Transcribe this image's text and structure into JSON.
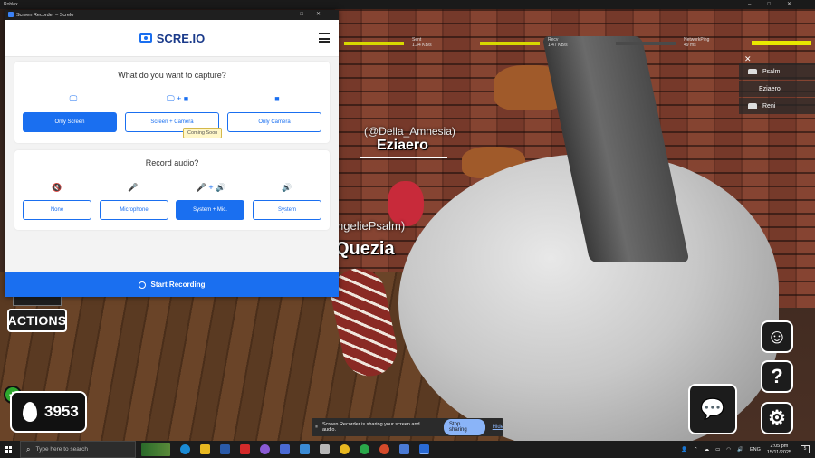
{
  "roblox": {
    "title": "Roblox"
  },
  "recorder": {
    "window_title": "Screen Recorder – Screlo",
    "logo_text": "SCRE.IO",
    "capture": {
      "title": "What do you want to capture?",
      "options": [
        "Only Screen",
        "Screen + Camera",
        "Only Camera"
      ],
      "selected": "Only Screen",
      "tooltip": "Coming Soon"
    },
    "audio": {
      "title": "Record audio?",
      "options": [
        "None",
        "Microphone",
        "System + Mic.",
        "System"
      ],
      "selected": "System + Mic."
    },
    "start_label": "Start Recording"
  },
  "game": {
    "stats": [
      {
        "label": "Sent",
        "value": "1.34 KB/s"
      },
      {
        "label": "Recv",
        "value": "1.47 KB/s"
      },
      {
        "label": "NetworkPing",
        "value": "49 ms"
      }
    ],
    "players": [
      "Psalm",
      "Eziaero",
      "Reni"
    ],
    "name_tags": {
      "eziaero_handle": "(@Della_Amnesia)",
      "eziaero_name": "Eziaero",
      "quezia_handle": "ngeliePsalm)",
      "quezia_name": "Quezia"
    },
    "actions_label": "ACTIONS",
    "drops_value": "3953",
    "plus_label": "+"
  },
  "sharing": {
    "message": "Screen Recorder is sharing your screen and audio.",
    "stop_label": "Stop sharing",
    "hide_label": "Hide"
  },
  "taskbar": {
    "search_placeholder": "Type here to search",
    "language": "ENG",
    "time": "2:05 pm",
    "date": "15/11/2025",
    "notifications": "5"
  }
}
